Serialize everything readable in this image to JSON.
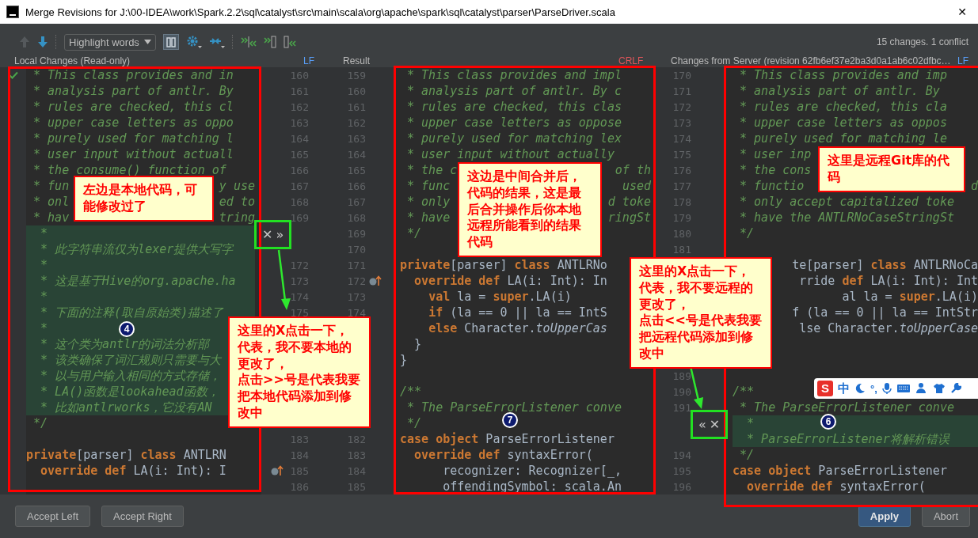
{
  "window": {
    "title": "Merge Revisions for J:\\00-IDEA\\work\\Spark.2.2\\sql\\catalyst\\src\\main\\scala\\org\\apache\\spark\\sql\\catalyst\\parser\\ParseDriver.scala",
    "close": "✕"
  },
  "toolbar": {
    "items": [
      {
        "kind": "up",
        "disabled": true
      },
      {
        "kind": "down",
        "disabled": false
      },
      {
        "kind": "dropdown",
        "label": "Highlight words"
      },
      {
        "kind": "toggle",
        "on": true
      },
      {
        "kind": "gear"
      },
      {
        "kind": "collapse"
      },
      {
        "kind": "accept-both"
      },
      {
        "kind": "accept-left"
      },
      {
        "kind": "accept-right"
      }
    ],
    "status": "15 changes. 1 conflict"
  },
  "panels": [
    {
      "header": {
        "title": "Local Changes (Read-only)",
        "separator": "LF"
      },
      "blocks": [
        {
          "kind": "comment",
          "changed": false,
          "lines": [
            " * This class provides and in",
            " * analysis part of antlr. By",
            " * rules are checked, this cl",
            " * upper case letters as oppo",
            " * purely used for matching l",
            " * user input without actuall",
            " * the consume() function of",
            {
              "text": " * fun",
              "tail": "y use"
            },
            {
              "text": " * onl",
              "tail": "ed to"
            },
            {
              "text": " * hav",
              "tail": "tring"
            }
          ]
        },
        {
          "kind": "comment",
          "changed": true,
          "lines": [
            "  *",
            "  * 此字符串流仅为lexer提供大写字",
            "  *",
            "  * 这是基于Hive的org.apache.ha",
            "  *",
            "  * 下面的注释(取自原始类)描述了",
            "  *",
            "  * 这个类为antlr的词法分析部",
            "  * 该类确保了词汇规则只需要与大",
            "  * 以与用户输入相同的方式存储，",
            "  * LA()函数是lookahead函数，",
            "  * 比如antlrworks，它没有AN"
          ]
        },
        {
          "kind": "comment",
          "changed": false,
          "lines": [
            " */"
          ]
        },
        {
          "kind": "code",
          "changed": false,
          "lines": [
            {
              "kind": "blank"
            },
            "**private**[parser] **class** ANTLRN",
            "  **override** **def** LA(i: Int): I"
          ]
        }
      ]
    },
    {
      "header": {
        "title": "Result",
        "separator": "CRLF"
      },
      "blocks": [
        {
          "kind": "comment",
          "changed": false,
          "lines": [
            " * This class provides and impl",
            " * analysis part of antlr. By c",
            " * rules are checked, this clas",
            " * upper case letters as oppose",
            " * purely used for matching lex",
            " * user input without actually",
            {
              "text": " * the c",
              "tail": "of th"
            },
            {
              "text": " * func",
              "tail": "used"
            },
            {
              "text": " * only",
              "tail": "d toke"
            },
            {
              "text": " * have",
              "tail": "ringSt"
            },
            " */"
          ]
        },
        {
          "kind": "code",
          "changed": false,
          "lines": [
            {
              "kind": "blank"
            },
            "**private**[parser] **class** ANTLRNo",
            "  **override** **def** LA(i: Int): In",
            "    **val** la = **super**.LA(i)",
            "    **if** (la == 0 || la == IntS",
            "    **else** Character.*toUpperCas*",
            "  }",
            "}",
            {
              "kind": "blank"
            }
          ]
        },
        {
          "kind": "comment",
          "changed": false,
          "lines": [
            "/**",
            " * The ParseErrorListener conve",
            " */"
          ]
        },
        {
          "kind": "code",
          "changed": false,
          "lines": [
            "**case** **object** ParseErrorListener",
            "  **override** **def** syntaxError(",
            "      recognizer: Recognizer[_,",
            "      offendingSymbol: scala.An"
          ]
        }
      ]
    },
    {
      "header": {
        "title": "Changes from Server (revision 62fb6ef37e2ba3d0a1ab6c02dfbc…",
        "separator": "LF"
      },
      "blocks": [
        {
          "kind": "comment",
          "changed": false,
          "lines": [
            " * This class provides and imp",
            " * analysis part of antlr. By",
            " * rules are checked, this cla",
            " * upper case letters as oppos",
            " * purely used for matching le",
            " * user inp",
            " * the cons",
            {
              "text": " * functio",
              "tail": "d"
            },
            " * only accept capitalized toke",
            " * have the ANTLRNoCaseStringSt",
            " */"
          ]
        },
        {
          "kind": "code",
          "changed": false,
          "lines": [
            {
              "kind": "blank"
            },
            {
              "tail": "te[parser] **class** ANTLRNoCa"
            },
            {
              "tail": "rride **def** LA(i: Int): Int"
            },
            {
              "tail": "al la = **super**.LA(i)"
            },
            {
              "tail": "f (la == 0 || la == IntStr"
            },
            {
              "tail": "lse Character.*toUpperCase*"
            },
            {
              "kind": "blank"
            },
            {
              "kind": "blank"
            },
            {
              "kind": "blank"
            }
          ]
        },
        {
          "kind": "comment",
          "changed": false,
          "lines": [
            "/**",
            " * The ParseErrorListener conve"
          ]
        },
        {
          "kind": "comment",
          "changed": true,
          "lines": [
            "  *",
            "  * ParseErrorListener将解析错误"
          ]
        },
        {
          "kind": "comment",
          "changed": false,
          "lines": [
            " */"
          ]
        },
        {
          "kind": "code",
          "changed": false,
          "lines": [
            "**case** **object** ParseErrorListener",
            "  **override** **def** syntaxError("
          ]
        }
      ]
    }
  ],
  "gutters": [
    {
      "columns": [
        [
          "160",
          "161",
          "162",
          "163",
          "164",
          "165",
          "166",
          "167",
          "168",
          "169",
          null,
          null,
          "172",
          "173",
          "174",
          "175",
          null,
          null,
          null,
          null,
          null,
          null,
          null,
          "183",
          "184",
          {
            "number": "185",
            "annotated": true
          },
          "186"
        ],
        [
          "159",
          "160",
          "161",
          "162",
          "163",
          "164",
          "165",
          "166",
          "167",
          "168",
          "169",
          "170",
          "171",
          {
            "number": "172",
            "annotated": true
          },
          "173",
          "174",
          null,
          null,
          null,
          null,
          null,
          null,
          null,
          "182",
          "183",
          "184",
          "185"
        ]
      ]
    },
    {
      "columns": [
        [
          "170",
          "171",
          "172",
          "173",
          "174",
          "175",
          "176",
          "177",
          "178",
          "179",
          "180",
          "181",
          null,
          null,
          null,
          null,
          null,
          null,
          null,
          "189",
          "190",
          "191",
          null,
          null,
          "194",
          "195",
          "196"
        ]
      ]
    }
  ],
  "conflict_controls": [
    {
      "buttons": [
        "✕",
        "»"
      ]
    },
    {
      "buttons": [
        "«",
        "✕"
      ]
    }
  ],
  "callouts": [
    {
      "paragraphs": [
        "左边是本地代码，可能修改过了"
      ]
    },
    {
      "paragraphs": [
        "这里的X点击一下，代表，我不要本地的更改了，",
        "点击>>号是代表我要把本地代码添加到修改中"
      ]
    },
    {
      "paragraphs": [
        "这边是中间合并后，代码的结果，这是最后合并操作后你本地远程所能看到的结果代码"
      ]
    },
    {
      "paragraphs": [
        "这里的X点击一下，代表，我不要远程的更改了，",
        "点击<<号是代表我要把远程代码添加到修改中"
      ]
    },
    {
      "paragraphs": [
        "这里是远程Git库的代码"
      ]
    }
  ],
  "badges": [
    "4",
    "7",
    "6"
  ],
  "ime_toolbar": {
    "logo": "S",
    "mode": "中",
    "punctuation": "°,"
  },
  "buttons": [
    {
      "label": "Accept Left",
      "kind": "normal"
    },
    {
      "label": "Accept Right",
      "kind": "normal"
    },
    {
      "label": "Apply",
      "kind": "default"
    },
    {
      "label": "Abort",
      "kind": "normal"
    }
  ]
}
